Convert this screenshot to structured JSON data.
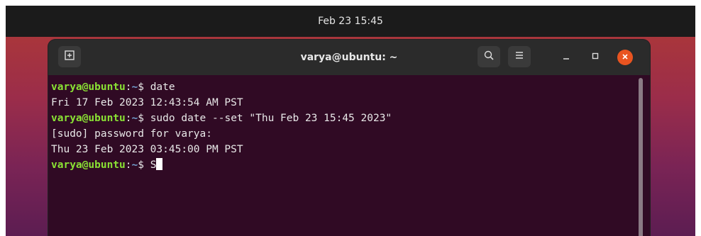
{
  "topbar": {
    "datetime": "Feb 23  15:45"
  },
  "window": {
    "title": "varya@ubuntu: ~",
    "buttons": {
      "new_tab_icon": "new-tab-icon",
      "search_icon": "search-icon",
      "menu_icon": "hamburger-menu-icon",
      "minimize_icon": "minimize-icon",
      "maximize_icon": "maximize-icon",
      "close_icon": "close-icon"
    }
  },
  "terminal": {
    "lines": [
      {
        "prompt_user": "varya@ubuntu",
        "prompt_sep": ":",
        "prompt_path": "~",
        "prompt_end": "$ ",
        "command": "date"
      },
      {
        "output": "Fri 17 Feb 2023 12:43:54 AM PST"
      },
      {
        "prompt_user": "varya@ubuntu",
        "prompt_sep": ":",
        "prompt_path": "~",
        "prompt_end": "$ ",
        "command": "sudo date --set \"Thu Feb 23 15:45 2023\""
      },
      {
        "output": "[sudo] password for varya:"
      },
      {
        "output": "Thu 23 Feb 2023 03:45:00 PM PST"
      },
      {
        "prompt_user": "varya@ubuntu",
        "prompt_sep": ":",
        "prompt_path": "~",
        "prompt_end": "$ ",
        "command": "S"
      }
    ]
  },
  "colors": {
    "terminal_bg": "#300a24",
    "prompt_user": "#8ae234",
    "prompt_path": "#729fcf",
    "close_button": "#e95420"
  }
}
